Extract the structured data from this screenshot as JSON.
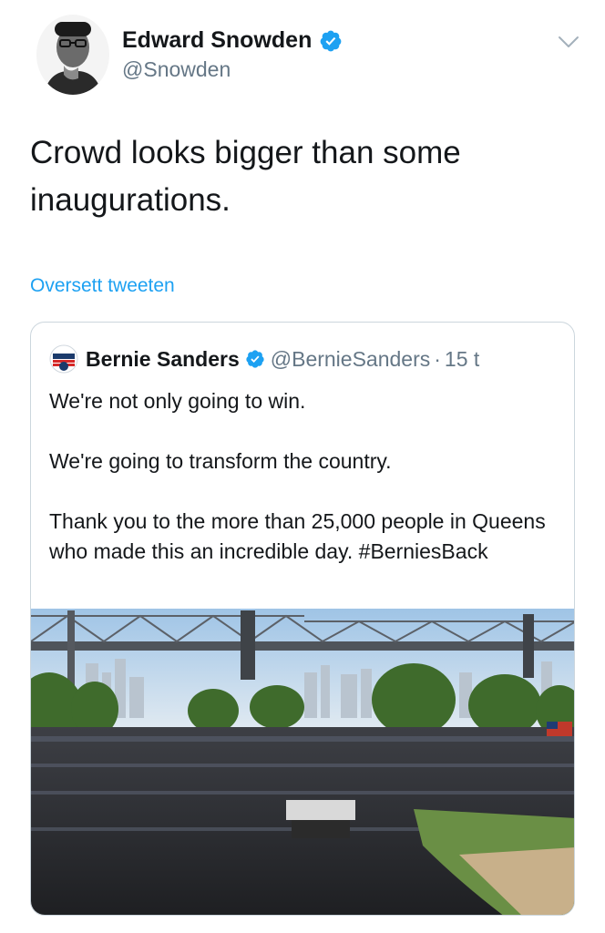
{
  "author": {
    "name": "Edward Snowden",
    "handle": "@Snowden",
    "verified": true,
    "avatar_icon": "avatar-photo-icon"
  },
  "tweet": {
    "text": "Crowd looks bigger than some inaugurations.",
    "translate_label": "Oversett tweeten"
  },
  "quoted": {
    "name": "Bernie Sanders",
    "handle": "@BernieSanders",
    "separator": "·",
    "time": "15 t",
    "paragraphs": [
      "We're not only going to win.",
      "We're going to transform the country.",
      "Thank you to the more than 25,000 people in Queens who made this an incredible day. #BerniesBack"
    ]
  },
  "colors": {
    "accent": "#1da1f2",
    "secondary_text": "#657786",
    "border": "#ccd6dd"
  }
}
